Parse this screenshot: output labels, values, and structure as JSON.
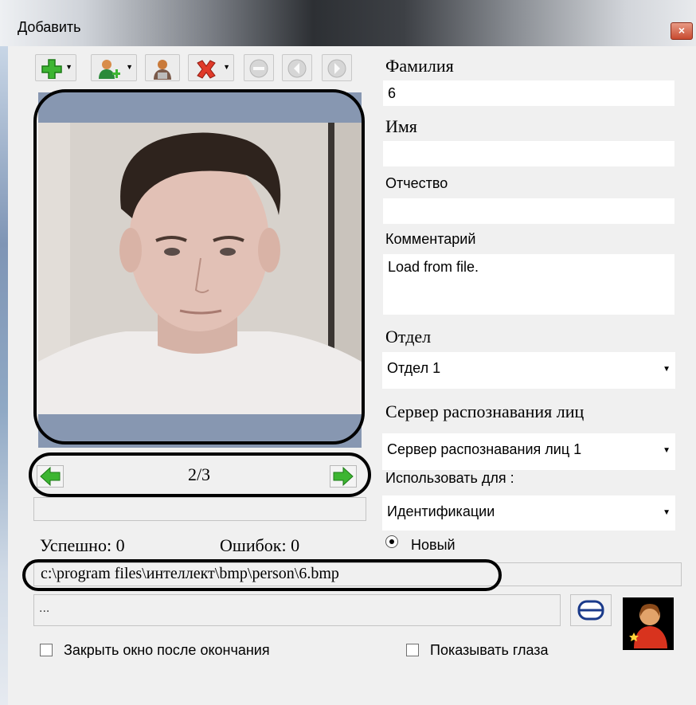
{
  "window": {
    "title": "Добавить",
    "close_label": "×"
  },
  "toolbar": {
    "icons": [
      "add-icon",
      "add-person-icon",
      "person-icon",
      "delete-icon",
      "remove-icon",
      "back-icon",
      "forward-icon"
    ]
  },
  "navigator": {
    "counter": "2/3"
  },
  "stats": {
    "success": "Успешно: 0",
    "errors": "Ошибок: 0"
  },
  "form": {
    "last_name_label": "Фамилия",
    "last_name_value": "6",
    "first_name_label": "Имя",
    "first_name_value": "",
    "patronymic_label": "Отчество",
    "patronymic_value": "",
    "comment_label": "Комментарий",
    "comment_value": "Load from file.",
    "department_label": "Отдел",
    "department_value": "Отдел 1",
    "server_label": "Сервер распознавания лиц",
    "server_value": "Сервер распознавания лиц 1",
    "use_for_label": "Использовать для :",
    "use_for_value": "Идентификации",
    "radio_new_label": "Новый"
  },
  "path": {
    "value": "c:\\program files\\интеллект\\bmp\\person\\6.bmp"
  },
  "log": {
    "value": "..."
  },
  "options": {
    "close_after": "Закрыть окно после окончания",
    "show_eyes": "Показывать глаза"
  },
  "colors": {
    "frame_bg": "#8797b1",
    "window_bg": "#f0f0f0",
    "close_red": "#c84a30"
  }
}
